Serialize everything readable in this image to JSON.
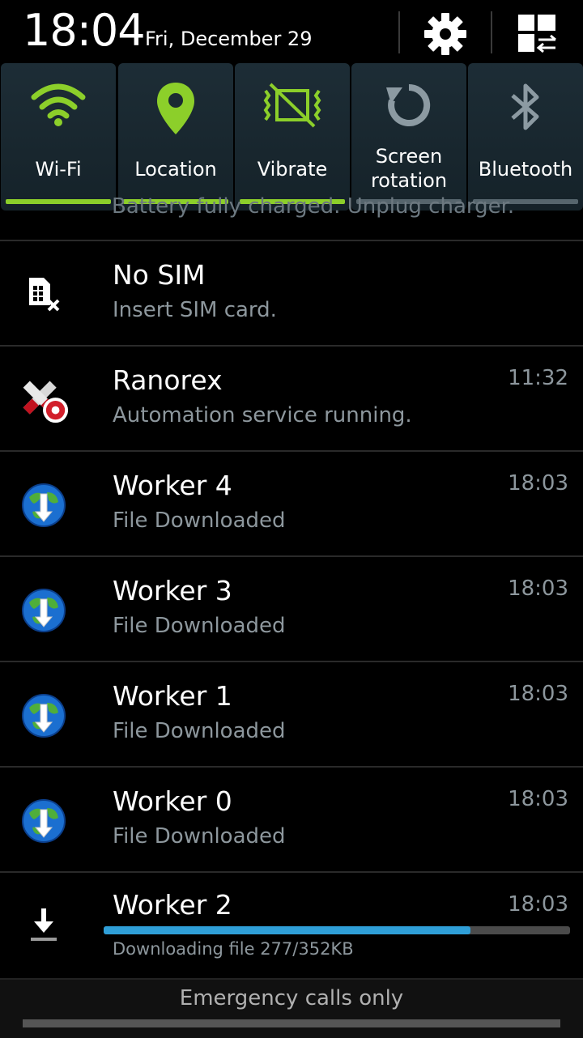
{
  "header": {
    "time": "18:04",
    "date": "Fri, December 29",
    "settings_icon": "gear-icon",
    "toggle_icon": "grid-switch-icon"
  },
  "quick_settings": [
    {
      "label": "Wi-Fi",
      "icon": "wifi-icon",
      "active": true
    },
    {
      "label": "Location",
      "icon": "location-pin-icon",
      "active": true
    },
    {
      "label": "Vibrate",
      "icon": "vibrate-icon",
      "active": true
    },
    {
      "label_line1": "Screen",
      "label_line2": "rotation",
      "icon": "rotation-icon",
      "active": false
    },
    {
      "label": "Bluetooth",
      "icon": "bluetooth-icon",
      "active": false
    }
  ],
  "colors": {
    "active_green": "#8ccf2a",
    "inactive_gray": "#56656d",
    "progress_blue": "#2f9fd8"
  },
  "notifications": {
    "cut_off_text": "Battery fully charged. Unplug charger.",
    "items": [
      {
        "title": "No SIM",
        "text": "Insert SIM card.",
        "time": "",
        "icon": "no-sim-icon"
      },
      {
        "title": "Ranorex",
        "text": "Automation service running.",
        "time": "11:32",
        "icon": "ranorex-icon"
      },
      {
        "title": "Worker 4",
        "text": "File Downloaded",
        "time": "18:03",
        "icon": "globe-download-icon"
      },
      {
        "title": "Worker 3",
        "text": "File Downloaded",
        "time": "18:03",
        "icon": "globe-download-icon"
      },
      {
        "title": "Worker 1",
        "text": "File Downloaded",
        "time": "18:03",
        "icon": "globe-download-icon"
      },
      {
        "title": "Worker 0",
        "text": "File Downloaded",
        "time": "18:03",
        "icon": "globe-download-icon"
      }
    ],
    "download": {
      "title": "Worker 2",
      "time": "18:03",
      "text": "Downloading file 277/352KB",
      "progress": 0.787,
      "icon": "download-arrow-icon"
    }
  },
  "footer": {
    "carrier": "Emergency calls only"
  }
}
